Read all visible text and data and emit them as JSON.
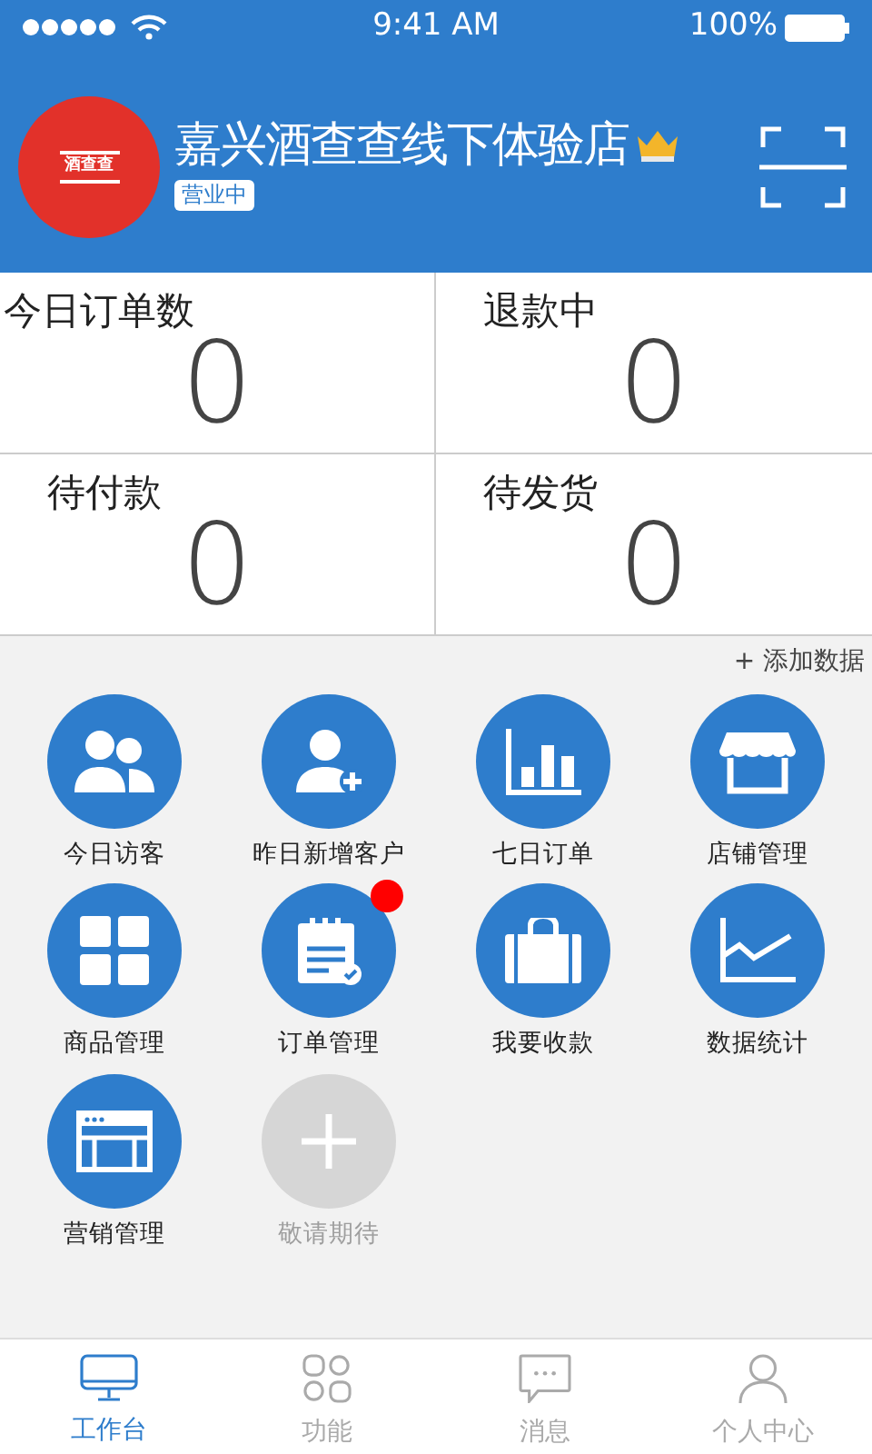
{
  "status_bar": {
    "time": "9:41 AM",
    "battery": "100%"
  },
  "header": {
    "logo_text": "酒查查",
    "store_name": "嘉兴酒查查线下体验店",
    "status": "营业中"
  },
  "stats": [
    {
      "label": "今日订单数",
      "value": "0"
    },
    {
      "label": "退款中",
      "value": "0"
    },
    {
      "label": "待付款",
      "value": "0"
    },
    {
      "label": "待发货",
      "value": "0"
    }
  ],
  "add_data": "+ 添加数据",
  "features": [
    {
      "label": "今日访客",
      "disabled": false,
      "badge": false
    },
    {
      "label": "昨日新增客户",
      "disabled": false,
      "badge": false
    },
    {
      "label": "七日订单",
      "disabled": false,
      "badge": false
    },
    {
      "label": "店铺管理",
      "disabled": false,
      "badge": false
    },
    {
      "label": "商品管理",
      "disabled": false,
      "badge": false
    },
    {
      "label": "订单管理",
      "disabled": false,
      "badge": true
    },
    {
      "label": "我要收款",
      "disabled": false,
      "badge": false
    },
    {
      "label": "数据统计",
      "disabled": false,
      "badge": false
    },
    {
      "label": "营销管理",
      "disabled": false,
      "badge": false
    },
    {
      "label": "敬请期待",
      "disabled": true,
      "badge": false
    }
  ],
  "tabs": [
    {
      "label": "工作台",
      "selected": true
    },
    {
      "label": "功能",
      "selected": false
    },
    {
      "label": "消息",
      "selected": false
    },
    {
      "label": "个人中心",
      "selected": false
    }
  ]
}
